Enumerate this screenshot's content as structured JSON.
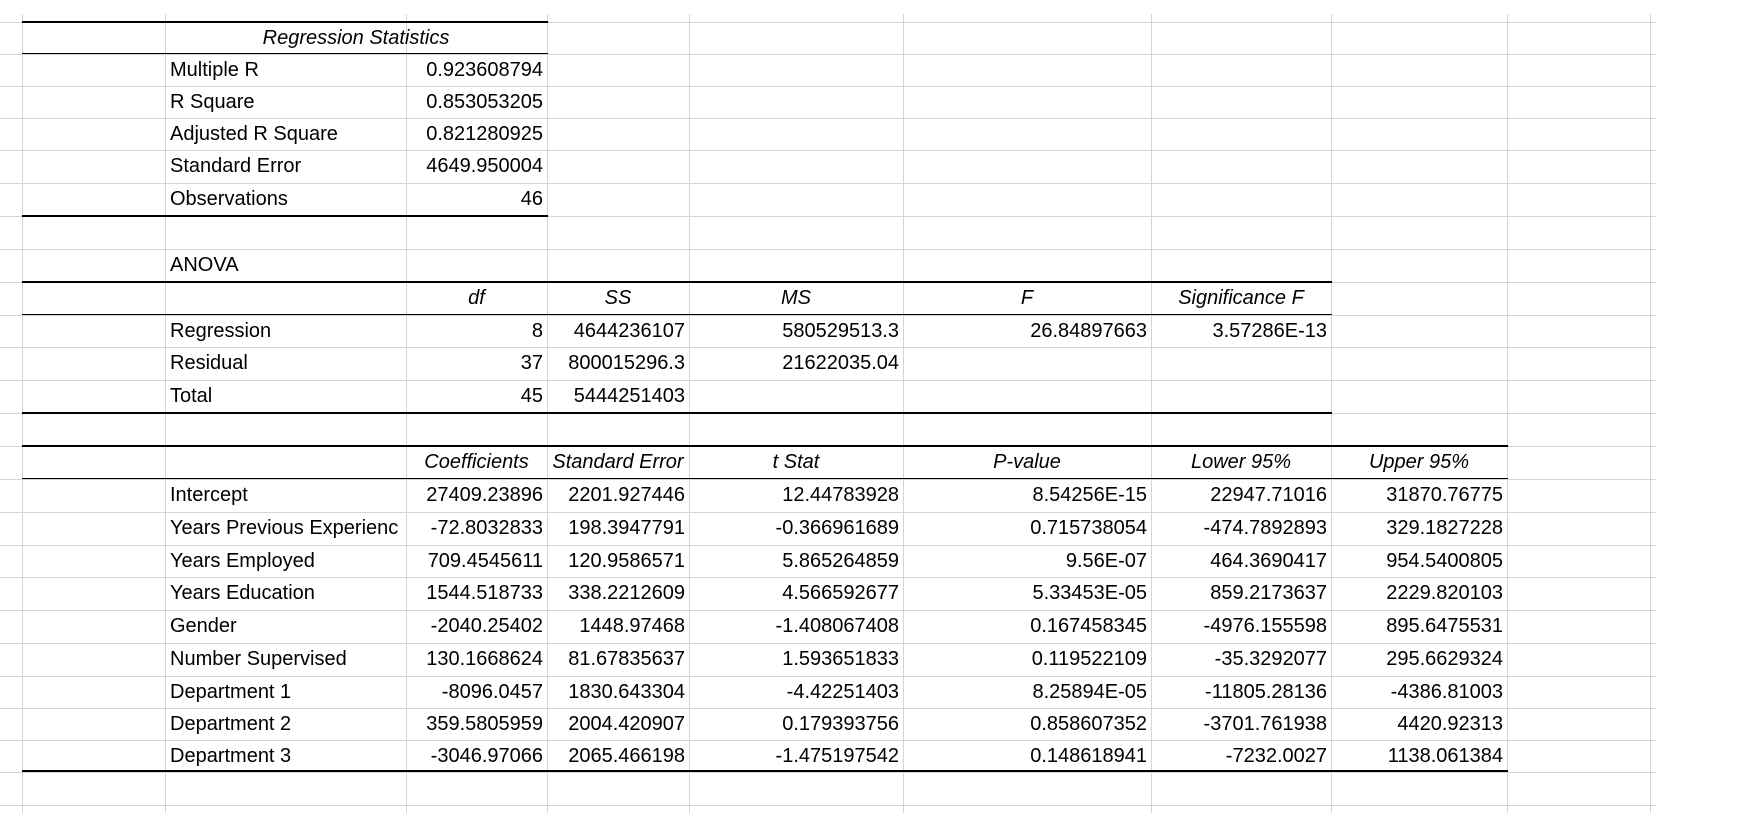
{
  "regression_statistics": {
    "title": "Regression Statistics",
    "rows": [
      {
        "label": "Multiple R",
        "value": "0.923608794"
      },
      {
        "label": "R Square",
        "value": "0.853053205"
      },
      {
        "label": "Adjusted R Square",
        "value": "0.821280925"
      },
      {
        "label": "Standard Error",
        "value": "4649.950004"
      },
      {
        "label": "Observations",
        "value": "46"
      }
    ]
  },
  "anova": {
    "title": "ANOVA",
    "headers": [
      "df",
      "SS",
      "MS",
      "F",
      "Significance F"
    ],
    "rows": [
      {
        "label": "Regression",
        "cells": [
          "8",
          "4644236107",
          "580529513.3",
          "26.84897663",
          "3.57286E-13"
        ]
      },
      {
        "label": "Residual",
        "cells": [
          "37",
          "800015296.3",
          "21622035.04",
          "",
          ""
        ]
      },
      {
        "label": "Total",
        "cells": [
          "45",
          "5444251403",
          "",
          "",
          ""
        ]
      }
    ]
  },
  "coefficients": {
    "headers": [
      "Coefficients",
      "Standard Error",
      "t Stat",
      "P-value",
      "Lower 95%",
      "Upper 95%"
    ],
    "rows": [
      {
        "label": "Intercept",
        "cells": [
          "27409.23896",
          "2201.927446",
          "12.44783928",
          "8.54256E-15",
          "22947.71016",
          "31870.76775"
        ]
      },
      {
        "label": "Years Previous Experienc",
        "cells": [
          "-72.8032833",
          "198.3947791",
          "-0.366961689",
          "0.715738054",
          "-474.7892893",
          "329.1827228"
        ]
      },
      {
        "label": "Years Employed",
        "cells": [
          "709.4545611",
          "120.9586571",
          "5.865264859",
          "9.56E-07",
          "464.3690417",
          "954.5400805"
        ]
      },
      {
        "label": "Years Education",
        "cells": [
          "1544.518733",
          "338.2212609",
          "4.566592677",
          "5.33453E-05",
          "859.2173637",
          "2229.820103"
        ]
      },
      {
        "label": "Gender",
        "cells": [
          "-2040.25402",
          "1448.97468",
          "-1.408067408",
          "0.167458345",
          "-4976.155598",
          "895.6475531"
        ]
      },
      {
        "label": "Number Supervised",
        "cells": [
          "130.1668624",
          "81.67835637",
          "1.593651833",
          "0.119522109",
          "-35.3292077",
          "295.6629324"
        ]
      },
      {
        "label": "Department 1",
        "cells": [
          "-8096.0457",
          "1830.643304",
          "-4.42251403",
          "8.25894E-05",
          "-11805.28136",
          "-4386.81003"
        ]
      },
      {
        "label": "Department 2",
        "cells": [
          "359.5805959",
          "2004.420907",
          "0.179393756",
          "0.858607352",
          "-3701.761938",
          "4420.92313"
        ]
      },
      {
        "label": "Department 3",
        "cells": [
          "-3046.97066",
          "2065.466198",
          "-1.475197542",
          "0.148618941",
          "-7232.0027",
          "1138.061384"
        ]
      }
    ]
  }
}
